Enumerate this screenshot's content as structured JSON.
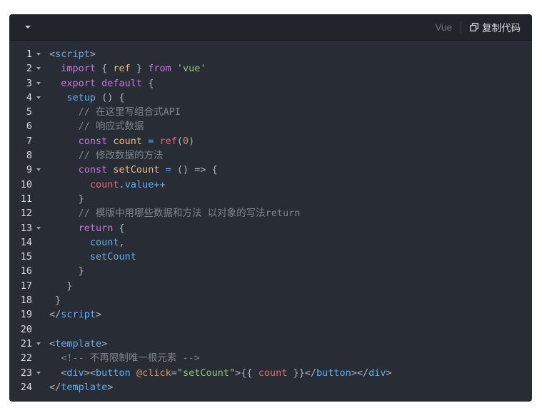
{
  "toolbar": {
    "language": "Vue",
    "copy_label": "复制代码",
    "collapse_icon": "caret-down-icon",
    "copy_icon": "copy-icon"
  },
  "colors": {
    "background": "#282c34",
    "toolbar_background": "#21252b",
    "keyword": "#c678dd",
    "tag": "#61afef",
    "string": "#98c379",
    "variable": "#e5c07b",
    "comment": "#7f848e",
    "function": "#e06c75",
    "number": "#d19a66"
  },
  "lines": [
    {
      "number": "1",
      "fold": true,
      "tokens": [
        {
          "t": "<",
          "c": "punc"
        },
        {
          "t": "script",
          "c": "tag"
        },
        {
          "t": ">",
          "c": "punc"
        }
      ]
    },
    {
      "number": "2",
      "fold": true,
      "tokens": [
        {
          "t": "  import",
          "c": "kw"
        },
        {
          "t": " { ",
          "c": "punc"
        },
        {
          "t": "ref",
          "c": "var"
        },
        {
          "t": " } ",
          "c": "punc"
        },
        {
          "t": "from",
          "c": "kw"
        },
        {
          "t": " ",
          "c": "plain"
        },
        {
          "t": "'vue'",
          "c": "str"
        }
      ]
    },
    {
      "number": "3",
      "fold": true,
      "tokens": [
        {
          "t": "  export",
          "c": "kw"
        },
        {
          "t": " ",
          "c": "plain"
        },
        {
          "t": "default",
          "c": "kw"
        },
        {
          "t": " {",
          "c": "punc"
        }
      ]
    },
    {
      "number": "4",
      "fold": true,
      "tokens": [
        {
          "t": "   setup",
          "c": "tag"
        },
        {
          "t": " () {",
          "c": "punc"
        }
      ]
    },
    {
      "number": "5",
      "fold": false,
      "tokens": [
        {
          "t": "     // 在这里写组合式API",
          "c": "cmt"
        }
      ]
    },
    {
      "number": "6",
      "fold": false,
      "tokens": [
        {
          "t": "     // 响应式数据",
          "c": "cmt"
        }
      ]
    },
    {
      "number": "7",
      "fold": false,
      "tokens": [
        {
          "t": "     const",
          "c": "kw"
        },
        {
          "t": " ",
          "c": "plain"
        },
        {
          "t": "count",
          "c": "var"
        },
        {
          "t": " = ",
          "c": "tag"
        },
        {
          "t": "ref",
          "c": "fn"
        },
        {
          "t": "(",
          "c": "punc"
        },
        {
          "t": "0",
          "c": "num"
        },
        {
          "t": ")",
          "c": "punc"
        }
      ]
    },
    {
      "number": "8",
      "fold": false,
      "tokens": [
        {
          "t": "     // 修改数据的方法",
          "c": "cmt"
        }
      ]
    },
    {
      "number": "9",
      "fold": true,
      "tokens": [
        {
          "t": "     const",
          "c": "kw"
        },
        {
          "t": " ",
          "c": "plain"
        },
        {
          "t": "setCount",
          "c": "var"
        },
        {
          "t": " = ",
          "c": "tag"
        },
        {
          "t": "() => {",
          "c": "punc"
        }
      ]
    },
    {
      "number": "10",
      "fold": false,
      "tokens": [
        {
          "t": "       count",
          "c": "fn"
        },
        {
          "t": ".",
          "c": "punc"
        },
        {
          "t": "value",
          "c": "prop"
        },
        {
          "t": "++",
          "c": "tag"
        }
      ]
    },
    {
      "number": "11",
      "fold": false,
      "tokens": [
        {
          "t": "     }",
          "c": "punc"
        }
      ]
    },
    {
      "number": "12",
      "fold": false,
      "tokens": [
        {
          "t": "     // 模版中用哪些数据和方法 以对象的写法return",
          "c": "cmt"
        }
      ]
    },
    {
      "number": "13",
      "fold": true,
      "tokens": [
        {
          "t": "     return",
          "c": "kw"
        },
        {
          "t": " {",
          "c": "punc"
        }
      ]
    },
    {
      "number": "14",
      "fold": false,
      "tokens": [
        {
          "t": "       count",
          "c": "prop"
        },
        {
          "t": ",",
          "c": "punc"
        }
      ]
    },
    {
      "number": "15",
      "fold": false,
      "tokens": [
        {
          "t": "       setCount",
          "c": "prop"
        }
      ]
    },
    {
      "number": "16",
      "fold": false,
      "tokens": [
        {
          "t": "     }",
          "c": "punc"
        }
      ]
    },
    {
      "number": "17",
      "fold": false,
      "tokens": [
        {
          "t": "   }",
          "c": "punc"
        }
      ]
    },
    {
      "number": "18",
      "fold": false,
      "tokens": [
        {
          "t": " }",
          "c": "punc"
        }
      ]
    },
    {
      "number": "19",
      "fold": false,
      "tokens": [
        {
          "t": "</",
          "c": "punc"
        },
        {
          "t": "script",
          "c": "tag"
        },
        {
          "t": ">",
          "c": "punc"
        }
      ]
    },
    {
      "number": "20",
      "fold": false,
      "tokens": []
    },
    {
      "number": "21",
      "fold": true,
      "tokens": [
        {
          "t": "<",
          "c": "punc"
        },
        {
          "t": "template",
          "c": "tag"
        },
        {
          "t": ">",
          "c": "punc"
        }
      ]
    },
    {
      "number": "22",
      "fold": false,
      "tokens": [
        {
          "t": "  <!-- 不再限制唯一根元素 -->",
          "c": "cmt"
        }
      ]
    },
    {
      "number": "23",
      "fold": true,
      "tokens": [
        {
          "t": "  <",
          "c": "punc"
        },
        {
          "t": "div",
          "c": "tag"
        },
        {
          "t": "><",
          "c": "punc"
        },
        {
          "t": "button",
          "c": "tag"
        },
        {
          "t": " ",
          "c": "plain"
        },
        {
          "t": "@click",
          "c": "attr"
        },
        {
          "t": "=",
          "c": "punc"
        },
        {
          "t": "\"setCount\"",
          "c": "str"
        },
        {
          "t": ">{{ ",
          "c": "punc"
        },
        {
          "t": "count",
          "c": "fn"
        },
        {
          "t": " }}</",
          "c": "punc"
        },
        {
          "t": "button",
          "c": "tag"
        },
        {
          "t": "></",
          "c": "punc"
        },
        {
          "t": "div",
          "c": "tag"
        },
        {
          "t": ">",
          "c": "punc"
        }
      ]
    },
    {
      "number": "24",
      "fold": false,
      "tokens": [
        {
          "t": "</",
          "c": "punc"
        },
        {
          "t": "template",
          "c": "tag"
        },
        {
          "t": ">",
          "c": "punc"
        }
      ]
    }
  ]
}
